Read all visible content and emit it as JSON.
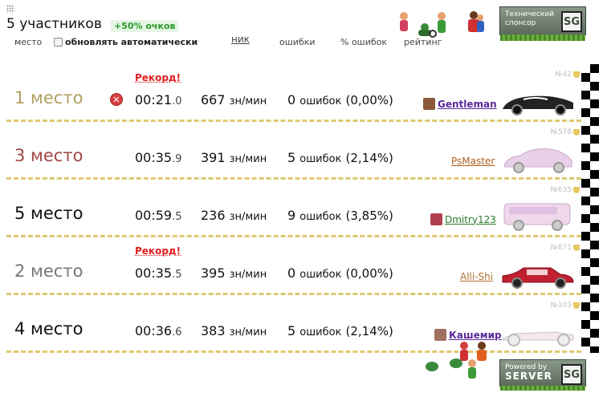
{
  "header": {
    "title": "5 участников",
    "bonus": "+50% очков",
    "columns": {
      "place": "место",
      "auto_refresh": "обновлять автоматически",
      "nick": "ник",
      "errors": "ошибки",
      "error_pct": "% ошибок",
      "rating": "рейтинг"
    },
    "auto_refresh_checked": false
  },
  "sponsor": {
    "top_line1": "Технический",
    "top_line2": "спонсор",
    "logo": "SG",
    "bottom_line1": "Powered by",
    "bottom_line2": "SERVER",
    "bottom_logo": "SG"
  },
  "rows": [
    {
      "place": "1 место",
      "record": "Рекорд!",
      "time": "00:21",
      "ms": ".0",
      "speed": "667",
      "speed_unit": "зн/мин",
      "errors": "0",
      "errors_unit": "ошибок",
      "pct": "(0,00%)",
      "nick": "Gentleman",
      "rank": "№42",
      "place_color": "#b0a060",
      "nick_color": "#5a2a9a",
      "car": "black-racing-car",
      "has_x": true
    },
    {
      "place": "3 место",
      "record": "",
      "time": "00:35",
      "ms": ".9",
      "speed": "391",
      "speed_unit": "зн/мин",
      "errors": "5",
      "errors_unit": "ошибок",
      "pct": "(2,14%)",
      "nick": "PsMaster",
      "rank": "№578",
      "place_color": "#a04848",
      "nick_color": "#b06020",
      "car": "pink-hatchback",
      "has_x": false
    },
    {
      "place": "5 место",
      "record": "",
      "time": "00:59",
      "ms": ".5",
      "speed": "236",
      "speed_unit": "зн/мин",
      "errors": "9",
      "errors_unit": "ошибок",
      "pct": "(3,85%)",
      "nick": "Dmitry123",
      "rank": "№635",
      "place_color": "#111111",
      "nick_color": "#2a7a2a",
      "car": "pink-minibus",
      "has_x": false
    },
    {
      "place": "2 место",
      "record": "Рекорд!",
      "time": "00:35",
      "ms": ".5",
      "speed": "395",
      "speed_unit": "зн/мин",
      "errors": "0",
      "errors_unit": "ошибок",
      "pct": "(0,00%)",
      "nick": "Alli-Shi",
      "rank": "№871",
      "place_color": "#777777",
      "nick_color": "#b07030",
      "car": "red-sedan",
      "has_x": false
    },
    {
      "place": "4 место",
      "record": "",
      "time": "00:36",
      "ms": ".6",
      "speed": "383",
      "speed_unit": "зн/мин",
      "errors": "5",
      "errors_unit": "ошибок",
      "pct": "(2,14%)",
      "nick": "Кашемир",
      "rank": "№103",
      "place_color": "#111111",
      "nick_color": "#5a2a9a",
      "car": "formula-car",
      "has_x": false
    }
  ]
}
